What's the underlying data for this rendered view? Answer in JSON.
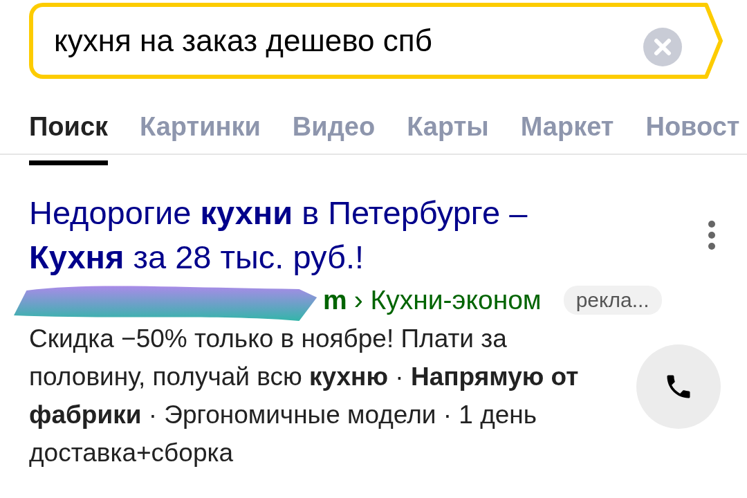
{
  "search": {
    "value": "кухня на заказ дешево спб"
  },
  "tabs": [
    {
      "label": "Поиск",
      "selected": true
    },
    {
      "label": "Картинки",
      "selected": false
    },
    {
      "label": "Видео",
      "selected": false
    },
    {
      "label": "Карты",
      "selected": false
    },
    {
      "label": "Маркет",
      "selected": false
    },
    {
      "label": "Новост",
      "selected": false
    }
  ],
  "result": {
    "title": "Недорогие **кухни** в Петербурге – **Кухня** за 28 тыс. руб.!",
    "url_tail": "m",
    "breadcrumb": "› Кухни-эконом",
    "badge": "рекла...",
    "text": "Скидка −50% только в ноябре! Плати за половину, получай всю **кухню** · **Напрямую от фабрики** · Эргономичные модели · 1 день доставка+сборка"
  }
}
